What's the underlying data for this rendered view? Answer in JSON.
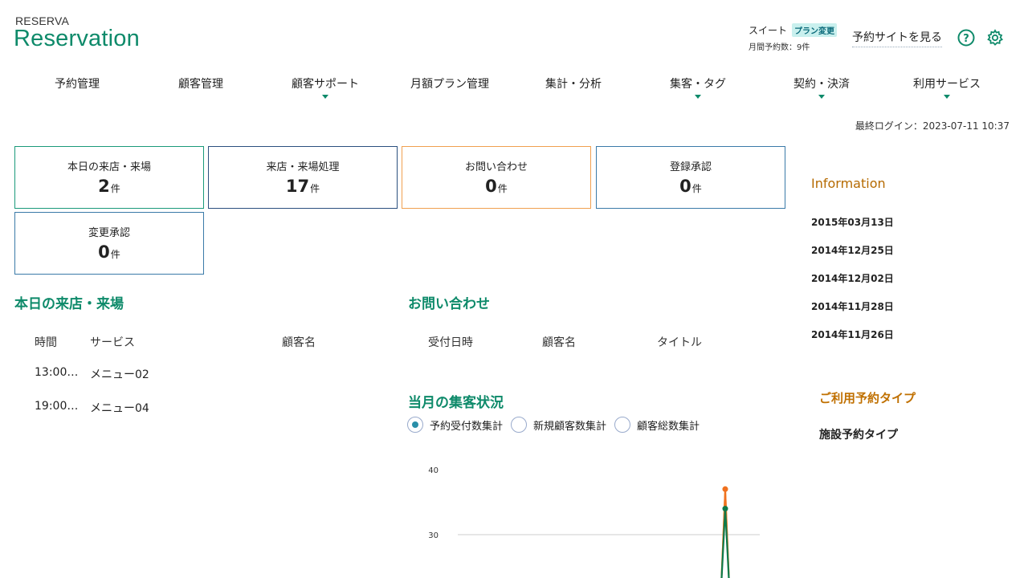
{
  "header": {
    "logo_small": "RESERVA",
    "logo_big": "Reservation",
    "plan_name": "スイート",
    "plan_change": "プラン変更",
    "monthly_bookings": "月間予約数：9件",
    "site_link": "予約サイトを見る",
    "help_icon": "question-circle-icon",
    "gear_icon": "gear-icon"
  },
  "nav": {
    "items": [
      {
        "label": "予約管理",
        "dropdown": false
      },
      {
        "label": "顧客管理",
        "dropdown": false
      },
      {
        "label": "顧客サポート",
        "dropdown": true
      },
      {
        "label": "月額プラン管理",
        "dropdown": false
      },
      {
        "label": "集計・分析",
        "dropdown": false
      },
      {
        "label": "集客・タグ",
        "dropdown": true
      },
      {
        "label": "契約・決済",
        "dropdown": true
      },
      {
        "label": "利用サービス",
        "dropdown": true
      }
    ]
  },
  "last_login": "最終ログイン：2023-07-11 10:37",
  "cards": [
    {
      "label": "本日の来店・来場",
      "value": "2",
      "unit": "件"
    },
    {
      "label": "来店・来場処理",
      "value": "17",
      "unit": "件"
    },
    {
      "label": "お問い合わせ",
      "value": "0",
      "unit": "件"
    },
    {
      "label": "登録承認",
      "value": "0",
      "unit": "件"
    },
    {
      "label": "変更承認",
      "value": "0",
      "unit": "件"
    }
  ],
  "today_visits": {
    "title": "本日の来店・来場",
    "columns": [
      "時間",
      "サービス",
      "顧客名"
    ],
    "rows": [
      {
        "time": "13:00…",
        "service": "メニュー02",
        "customer": ""
      },
      {
        "time": "19:00…",
        "service": "メニュー04",
        "customer": ""
      }
    ]
  },
  "inquiries": {
    "title": "お問い合わせ",
    "columns": [
      "受付日時",
      "顧客名",
      "タイトル"
    ]
  },
  "monthly": {
    "title": "当月の集客状況",
    "options": [
      {
        "label": "予約受付数集計",
        "selected": true
      },
      {
        "label": "新規顧客数集計",
        "selected": false
      },
      {
        "label": "顧客総数集計",
        "selected": false
      }
    ]
  },
  "information": {
    "title": "Information",
    "dates": [
      "2015年03月13日",
      "2014年12月25日",
      "2014年12月02日",
      "2014年11月28日",
      "2014年11月26日"
    ]
  },
  "reservation_type": {
    "title": "ご利用予約タイプ",
    "value": "施設予約タイプ"
  },
  "colors": {
    "brand": "#0e8a6a",
    "info_title": "#b56a00",
    "series_orange": "#f07020",
    "series_green": "#0e7a4a",
    "series_yellow": "#f0c020"
  },
  "chart_data": {
    "type": "line",
    "ytick_labels": [
      "40",
      "30"
    ],
    "visible_ylim": [
      25,
      41
    ],
    "series": [
      {
        "color": "#f0c020",
        "peak": 37
      },
      {
        "color": "#f07020",
        "peak": 37
      },
      {
        "color": "#0e7a4a",
        "peak": 34
      }
    ]
  }
}
